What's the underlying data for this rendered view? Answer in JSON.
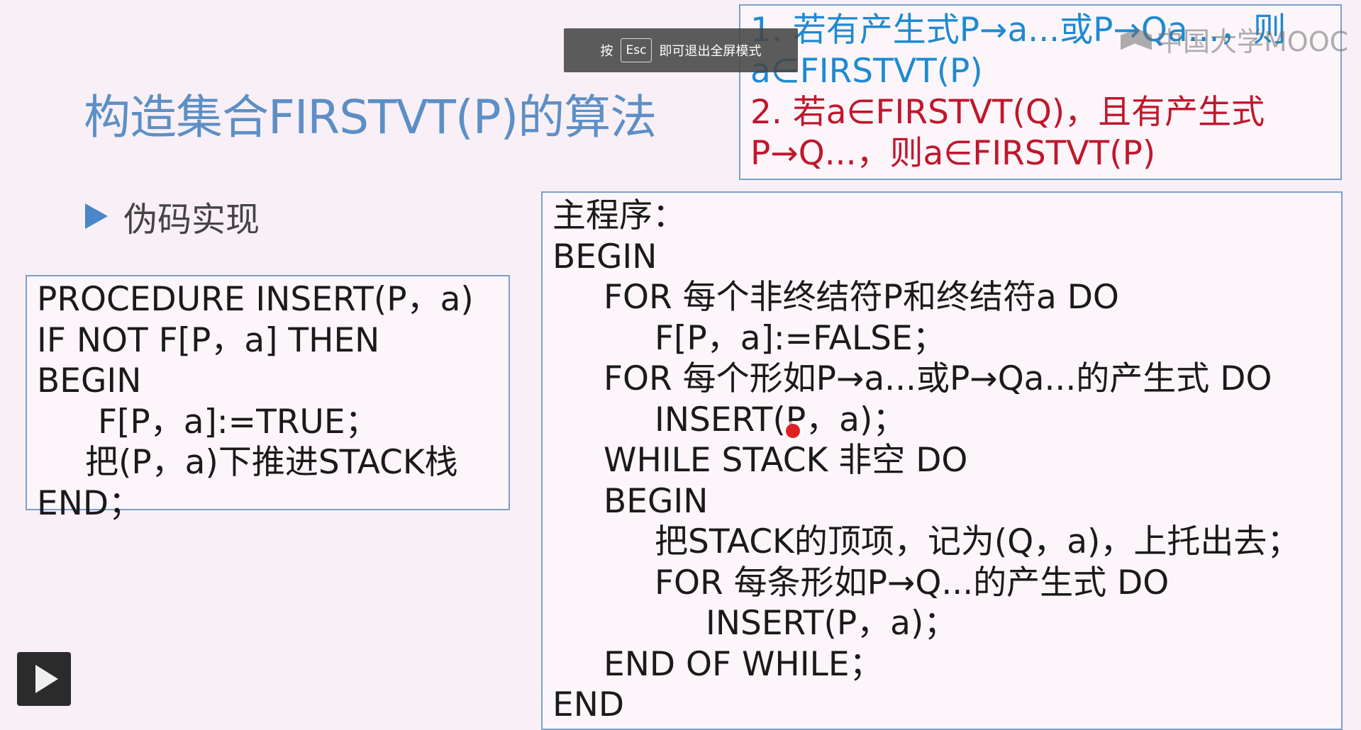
{
  "slide": {
    "title": "构造集合FIRSTVT(P)的算法",
    "subtitle": "伪码实现"
  },
  "rules": {
    "line1": "1. 若有产生式P→a...或P→Qa...，则",
    "line2": "a∈FIRSTVT(P)",
    "line3": "2. 若a∈FIRSTVT(Q)，且有产生式",
    "line4": "P→Q...，则a∈FIRSTVT(P)"
  },
  "insert_proc": {
    "line1": "PROCEDURE  INSERT(P，a)",
    "line2": "IF  NOT  F[P，a]  THEN",
    "line3": "BEGIN",
    "line4": "F[P，a]:=TRUE；",
    "line5": "把(P，a)下推进STACK栈",
    "line6": "END；"
  },
  "main_program": {
    "line1": "主程序：",
    "line2": "BEGIN",
    "line3": "FOR  每个非终结符P和终结符a  DO",
    "line4": "F[P，a]:=FALSE；",
    "line5": "FOR  每个形如P→a...或P→Qa...的产生式  DO",
    "line6": "INSERT(P，a)；",
    "line7": "WHILE STACK 非空 DO",
    "line8": "BEGIN",
    "line9": "把STACK的顶项，记为(Q，a)，上托出去；",
    "line10": "FOR 每条形如P→Q...的产生式   DO",
    "line11": "INSERT(P，a)；",
    "line12": "END OF WHILE；",
    "line13": "END"
  },
  "overlay": {
    "prefix": "按",
    "key": "Esc",
    "suffix": "即可退出全屏模式"
  },
  "watermark": "中国大学MOOC",
  "colors": {
    "title": "#5d8fc6",
    "blue_text": "#1e8ad2",
    "red_text": "#c0172c",
    "border": "#7da0c8"
  },
  "icons": [
    "triangle-bullet-icon",
    "play-icon",
    "mooc-logo-icon"
  ]
}
